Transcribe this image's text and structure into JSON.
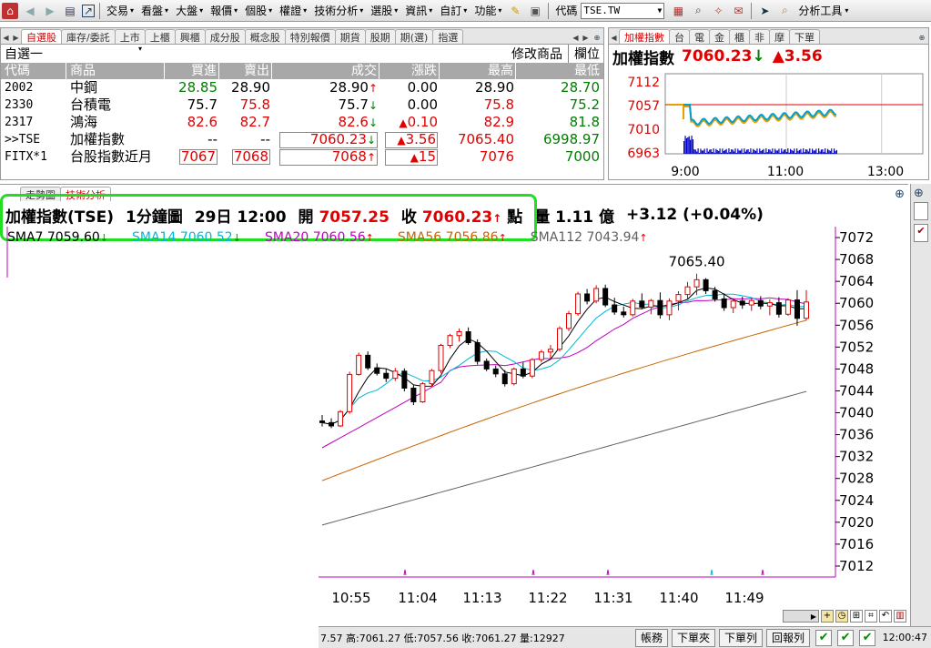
{
  "menubar": {
    "items": [
      "交易",
      "看盤",
      "大盤",
      "報價",
      "個股",
      "權證",
      "技術分析",
      "選股",
      "資訊",
      "自訂",
      "功能"
    ],
    "code_label": "代碼",
    "code_value": "TSE.TW",
    "analysis_tools": "分析工具"
  },
  "watchlist": {
    "tabs": [
      "自選股",
      "庫存/委託",
      "上市",
      "上櫃",
      "興櫃",
      "成分股",
      "概念股",
      "特別報價",
      "期貨",
      "股期",
      "期(選)",
      "指選"
    ],
    "active_tab": "自選股",
    "group_name": "自選一",
    "modify_btn": "修改商品",
    "columns_btn": "欄位",
    "headers": [
      "代碼",
      "商品",
      "買進",
      "賣出",
      "成交",
      "漲跌",
      "最高",
      "最低"
    ],
    "rows": [
      {
        "code": "2002",
        "name": "中鋼",
        "bid": "28.85",
        "ask": "28.90",
        "last": "28.90",
        "chg": "0.00",
        "high": "28.90",
        "low": "28.70",
        "last_arrow": "↑",
        "chg_arrow": "",
        "bid_c": "grn",
        "ask_c": "blk",
        "last_c": "blk",
        "chg_c": "blk",
        "high_c": "blk",
        "low_c": "grn"
      },
      {
        "code": "2330",
        "name": "台積電",
        "bid": "75.7",
        "ask": "75.8",
        "last": "75.7",
        "chg": "0.00",
        "high": "75.8",
        "low": "75.2",
        "last_arrow": "↓",
        "chg_arrow": "",
        "bid_c": "blk",
        "ask_c": "red",
        "last_c": "blk",
        "chg_c": "blk",
        "high_c": "red",
        "low_c": "grn"
      },
      {
        "code": "2317",
        "name": "鴻海",
        "bid": "82.6",
        "ask": "82.7",
        "last": "82.6",
        "chg": "0.10",
        "high": "82.9",
        "low": "81.8",
        "last_arrow": "↓",
        "chg_arrow": "▲",
        "bid_c": "red",
        "ask_c": "red",
        "last_c": "red",
        "chg_c": "red",
        "high_c": "red",
        "low_c": "grn"
      },
      {
        "code": ">>TSE",
        "name": "加權指數",
        "bid": "--",
        "ask": "--",
        "last": "7060.23",
        "chg": "3.56",
        "high": "7065.40",
        "low": "6998.97",
        "last_arrow": "↓",
        "chg_arrow": "▲",
        "bid_c": "blk",
        "ask_c": "blk",
        "last_c": "red",
        "chg_c": "red",
        "high_c": "red",
        "low_c": "grn"
      },
      {
        "code": "FITX*1",
        "name": "台股指數近月",
        "bid": "7067",
        "ask": "7068",
        "last": "7068",
        "chg": "15",
        "high": "7076",
        "low": "7000",
        "last_arrow": "↑",
        "chg_arrow": "▲",
        "bid_c": "red",
        "ask_c": "red",
        "last_c": "red",
        "chg_c": "red",
        "high_c": "red",
        "low_c": "grn"
      }
    ]
  },
  "mini": {
    "tabs": [
      "加權指數",
      "台",
      "電",
      "金",
      "櫃",
      "非",
      "摩",
      "下單"
    ],
    "title": "加權指數",
    "price": "7060.23",
    "price_arrow": "↓",
    "change": "3.56",
    "change_arrow": "▲",
    "y_ticks": [
      "7112",
      "7057",
      "7010",
      "6963"
    ],
    "x_ticks": [
      "9:00",
      "11:00",
      "13:00"
    ]
  },
  "chart": {
    "tabs": [
      "走勢圖",
      "技術分析"
    ],
    "info": {
      "symbol": "加權指數(TSE)",
      "period": "1分鐘圖",
      "datetime": "29日 12:00",
      "open_label": "開",
      "open": "7057.25",
      "close_label": "收",
      "close": "7060.23",
      "close_arrow": "↑",
      "unit": "點",
      "vol_label": "量",
      "vol": "1.11",
      "vol_unit": "億",
      "change": "+3.12 (+0.04%)"
    },
    "sma": [
      {
        "label": "SMA7 7059.60",
        "arrow": "↓",
        "color": "#000000",
        "arrow_color": "#008000"
      },
      {
        "label": "SMA14 7060.52",
        "arrow": "↓",
        "color": "#00b8d8",
        "arrow_color": "#008000"
      },
      {
        "label": "SMA20 7060.56",
        "arrow": "↑",
        "color": "#c000c0",
        "arrow_color": "#e00000"
      },
      {
        "label": "SMA56 7056.86",
        "arrow": "↑",
        "color": "#c86400",
        "arrow_color": "#e00000"
      },
      {
        "label": "SMA112 7043.94",
        "arrow": "↑",
        "color": "#606060",
        "arrow_color": "#e00000"
      }
    ],
    "high_annotation": "7065.40"
  },
  "chart_data": {
    "type": "candlestick",
    "ylim": [
      7010,
      7074
    ],
    "y_ticks": [
      7072,
      7068,
      7064,
      7060,
      7056,
      7052,
      7048,
      7044,
      7040,
      7036,
      7032,
      7028,
      7024,
      7020,
      7016,
      7012
    ],
    "x_ticks": [
      "10:55",
      "11:04",
      "11:13",
      "11:22",
      "11:31",
      "11:40",
      "11:49"
    ],
    "annotation": {
      "text": "7065.40",
      "value": 7065.4
    },
    "candles": [
      [
        7038.5,
        7039.6,
        7037.5,
        7038.2
      ],
      [
        7038.2,
        7039.0,
        7037.2,
        7037.6
      ],
      [
        7037.6,
        7040.5,
        7037.4,
        7040.2
      ],
      [
        7040.2,
        7047.5,
        7039.8,
        7047.0
      ],
      [
        7047.0,
        7051.0,
        7046.8,
        7050.5
      ],
      [
        7050.5,
        7051.2,
        7047.8,
        7048.2
      ],
      [
        7048.2,
        7049.0,
        7046.8,
        7047.2
      ],
      [
        7047.2,
        7048.0,
        7045.6,
        7046.3
      ],
      [
        7046.3,
        7048.2,
        7045.8,
        7047.6
      ],
      [
        7047.6,
        7048.1,
        7043.9,
        7044.5
      ],
      [
        7044.5,
        7045.0,
        7041.4,
        7042.0
      ],
      [
        7042.0,
        7045.6,
        7041.8,
        7045.3
      ],
      [
        7045.3,
        7048.0,
        7044.8,
        7047.7
      ],
      [
        7047.7,
        7052.6,
        7047.2,
        7052.3
      ],
      [
        7052.3,
        7054.4,
        7051.8,
        7054.1
      ],
      [
        7054.1,
        7055.4,
        7053.0,
        7054.8
      ],
      [
        7054.8,
        7055.6,
        7052.4,
        7052.8
      ],
      [
        7052.8,
        7053.4,
        7048.8,
        7049.4
      ],
      [
        7049.4,
        7049.9,
        7047.6,
        7048.0
      ],
      [
        7048.0,
        7048.6,
        7046.5,
        7047.1
      ],
      [
        7047.1,
        7047.8,
        7044.8,
        7045.3
      ],
      [
        7045.3,
        7048.3,
        7045.0,
        7048.0
      ],
      [
        7048.0,
        7049.2,
        7046.3,
        7046.7
      ],
      [
        7046.7,
        7050.0,
        7046.3,
        7049.7
      ],
      [
        7049.7,
        7051.5,
        7049.2,
        7051.1
      ],
      [
        7051.1,
        7052.4,
        7050.0,
        7051.6
      ],
      [
        7051.6,
        7055.8,
        7051.2,
        7055.4
      ],
      [
        7055.4,
        7058.6,
        7054.9,
        7058.1
      ],
      [
        7058.1,
        7062.1,
        7057.7,
        7061.7
      ],
      [
        7061.7,
        7062.6,
        7059.8,
        7060.4
      ],
      [
        7060.4,
        7063.3,
        7060.0,
        7062.7
      ],
      [
        7062.7,
        7063.4,
        7059.3,
        7059.7
      ],
      [
        7059.7,
        7061.0,
        7057.9,
        7058.4
      ],
      [
        7058.4,
        7059.4,
        7057.4,
        7057.9
      ],
      [
        7057.9,
        7060.8,
        7057.6,
        7060.4
      ],
      [
        7060.4,
        7061.8,
        7058.9,
        7059.3
      ],
      [
        7059.3,
        7060.8,
        7058.0,
        7060.5
      ],
      [
        7060.5,
        7062.0,
        7057.2,
        7057.9
      ],
      [
        7057.9,
        7060.9,
        7056.9,
        7060.4
      ],
      [
        7060.4,
        7062.2,
        7058.7,
        7061.6
      ],
      [
        7061.6,
        7063.9,
        7060.8,
        7063.0
      ],
      [
        7063.0,
        7065.4,
        7061.5,
        7064.3
      ],
      [
        7064.3,
        7064.6,
        7061.7,
        7062.3
      ],
      [
        7062.3,
        7063.0,
        7060.3,
        7060.8
      ],
      [
        7060.8,
        7061.8,
        7058.6,
        7059.2
      ],
      [
        7059.2,
        7060.9,
        7058.2,
        7060.4
      ],
      [
        7060.4,
        7061.2,
        7059.0,
        7059.7
      ],
      [
        7059.7,
        7061.0,
        7058.6,
        7060.5
      ],
      [
        7060.5,
        7061.3,
        7058.9,
        7059.5
      ],
      [
        7059.5,
        7060.7,
        7057.8,
        7060.1
      ],
      [
        7060.1,
        7061.1,
        7057.4,
        7058.0
      ],
      [
        7058.0,
        7060.9,
        7057.7,
        7060.6
      ],
      [
        7060.6,
        7062.4,
        7055.9,
        7057.25
      ],
      [
        7057.25,
        7062.4,
        7056.9,
        7060.23
      ]
    ]
  }
}
